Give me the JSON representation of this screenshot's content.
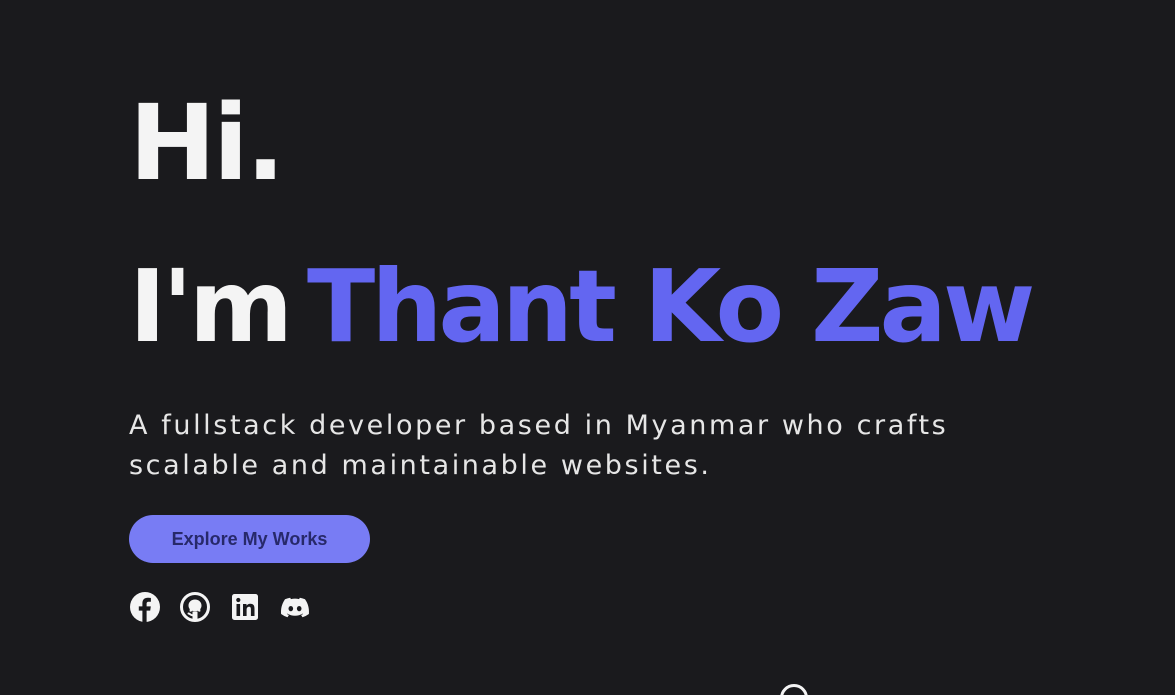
{
  "hero": {
    "greeting": "Hi.",
    "intro_prefix": "I'm",
    "name": "Thant Ko Zaw",
    "tagline": "A fullstack developer based in Myanmar who crafts scalable and maintainable websites.",
    "cta_label": "Explore My Works"
  },
  "socials": [
    {
      "icon": "facebook-icon"
    },
    {
      "icon": "github-icon"
    },
    {
      "icon": "linkedin-icon"
    },
    {
      "icon": "discord-icon"
    }
  ],
  "colors": {
    "background": "#1a1a1d",
    "accent": "#6366f1",
    "button": "#787cf4",
    "button_text": "#27296a",
    "text": "#f4f4f4"
  }
}
